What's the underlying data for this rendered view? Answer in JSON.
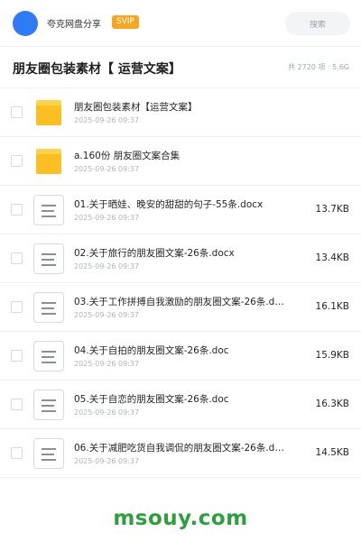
{
  "header": {
    "share_name": "夸克网盘分享",
    "badge": "SVIP",
    "search_label": "搜索",
    "avatar_color": "#2f7bf5"
  },
  "folder": {
    "title": "朋友圈包装素材【 运营文案】",
    "meta": "共 2720 项 · 5.6G"
  },
  "files": [
    {
      "type": "folder",
      "name": "朋友圈包装素材【运营文案】",
      "date": "2025-09-26 09:37",
      "size": ""
    },
    {
      "type": "folder",
      "name": "a.160份 朋友圈文案合集",
      "date": "2025-09-26 09:37",
      "size": ""
    },
    {
      "type": "doc",
      "name": "01.关于晒娃、晚安的甜甜的句子-55条.docx",
      "date": "2025-09-26 09:37",
      "size": "13.7KB"
    },
    {
      "type": "doc",
      "name": "02.关于旅行的朋友圈文案-26条.docx",
      "date": "2025-09-26 09:37",
      "size": "13.4KB"
    },
    {
      "type": "doc",
      "name": "03.关于工作拼搏自我激励的朋友圈文案-26条.d…",
      "date": "2025-09-26 09:37",
      "size": "16.1KB"
    },
    {
      "type": "doc",
      "name": "04.关于自拍的朋友圈文案-26条.doc",
      "date": "2025-09-26 09:37",
      "size": "15.9KB"
    },
    {
      "type": "doc",
      "name": "05.关于自恋的朋友圈文案-26条.doc",
      "date": "2025-09-26 09:37",
      "size": "16.3KB"
    },
    {
      "type": "doc",
      "name": "06.关于减肥吃货自我调侃的朋友圈文案-26条.d…",
      "date": "2025-09-26 09:37",
      "size": "14.5KB"
    }
  ],
  "watermark": "msouy.com",
  "colors": {
    "accent": "#2f7bf5",
    "badge": "#f5a623",
    "folder": "#fbbf24",
    "watermark": "#2e9e3e"
  }
}
